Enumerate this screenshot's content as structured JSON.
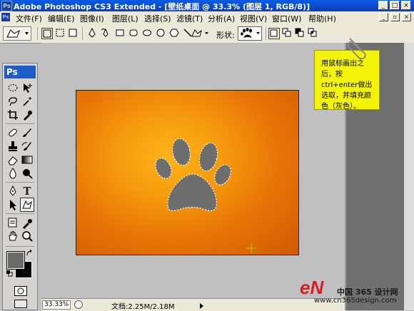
{
  "window": {
    "title": "Adobe Photoshop CS3 Extended - [壁纸桌面 @ 33.3% (图层 1, RGB/8)]",
    "logo": "Ps"
  },
  "menu": {
    "items": [
      "文件(F)",
      "编辑(E)",
      "图像(I)",
      "图层(L)",
      "选择(S)",
      "滤镜(T)",
      "分析(A)",
      "视图(V)",
      "窗口(W)",
      "帮助(H)"
    ]
  },
  "options": {
    "shape_label": "形状:"
  },
  "toolbox": {
    "logo": "Ps"
  },
  "note": {
    "text": "用鼠标画出之后，按ctrl+enter做出选取，并填充颜色（灰色）。"
  },
  "status": {
    "zoom": "33.33%",
    "doc_info": "文档:2.25M/2.18M"
  },
  "watermark": {
    "brand": "eN",
    "site_name": "中国 365 设计网",
    "url": "www.cn365design.com"
  },
  "colors": {
    "foreground": "#6b6b6b",
    "background": "#000000",
    "canvas_orange": "#e87406",
    "note_yellow": "#f4f30a",
    "paw_gray": "#6e6e6e"
  }
}
